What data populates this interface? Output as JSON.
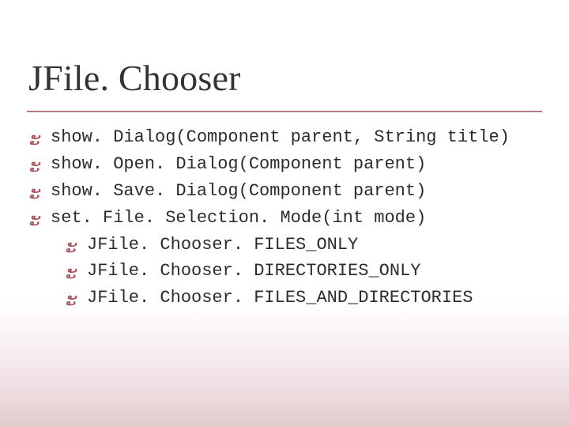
{
  "slide": {
    "title": "JFile. Chooser",
    "bullets": [
      {
        "text": "show. Dialog(Component parent, String title)"
      },
      {
        "text": "show. Open. Dialog(Component parent)"
      },
      {
        "text": "show. Save. Dialog(Component parent)"
      },
      {
        "text": "set. File. Selection. Mode(int mode)",
        "sub": [
          {
            "text": "JFile. Chooser. FILES_ONLY"
          },
          {
            "text": "JFile. Chooser. DIRECTORIES_ONLY"
          },
          {
            "text": "JFile. Chooser. FILES_AND_DIRECTORIES"
          }
        ]
      }
    ],
    "bullet_glyph": "་"
  }
}
